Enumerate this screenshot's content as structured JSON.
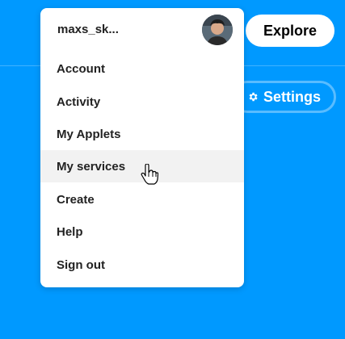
{
  "header": {
    "explore_label": "Explore",
    "settings_label": "Settings"
  },
  "menu": {
    "username": "maxs_sk...",
    "items": [
      {
        "label": "Account"
      },
      {
        "label": "Activity"
      },
      {
        "label": "My Applets"
      },
      {
        "label": "My services"
      },
      {
        "label": "Create"
      },
      {
        "label": "Help"
      },
      {
        "label": "Sign out"
      }
    ],
    "hovered_item": "My services"
  },
  "colors": {
    "background": "#0099ff",
    "menu_background": "#ffffff",
    "hover_background": "#f2f2f2",
    "text": "#222222"
  },
  "icons": {
    "settings": "gear-icon",
    "cursor": "hand-pointer-cursor",
    "avatar": "user-avatar"
  }
}
